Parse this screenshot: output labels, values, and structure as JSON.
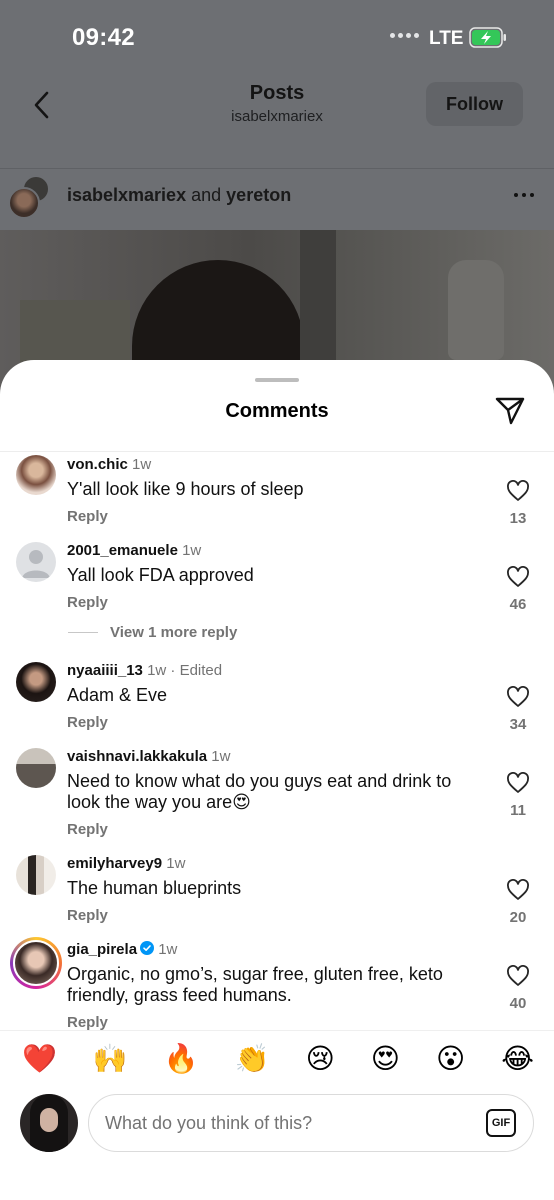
{
  "status_bar": {
    "time": "09:42",
    "network": "LTE"
  },
  "header": {
    "title": "Posts",
    "subtitle": "isabelxmariex",
    "follow_label": "Follow"
  },
  "post": {
    "author1": "isabelxmariex",
    "joiner": "and",
    "author2": "yereton"
  },
  "sheet": {
    "title": "Comments"
  },
  "comments": [
    {
      "user": "von.chic",
      "meta": "1w",
      "text": "Y'all look like 9 hours of sleep",
      "reply": "Reply",
      "likes": "13"
    },
    {
      "user": "2001_emanuele",
      "meta": "1w",
      "text": "Yall look FDA approved",
      "reply": "Reply",
      "likes": "46",
      "view_more": "View 1 more reply"
    },
    {
      "user": "nyaaiiii_13",
      "meta": "1w · Edited",
      "text": "Adam & Eve",
      "reply": "Reply",
      "likes": "34"
    },
    {
      "user": "vaishnavi.lakkakula",
      "meta": "1w",
      "text": "Need to know what do you guys eat and drink to look the way you are😍",
      "reply": "Reply",
      "likes": "11"
    },
    {
      "user": "emilyharvey9",
      "meta": "1w",
      "text": "The human blueprints",
      "reply": "Reply",
      "likes": "20"
    },
    {
      "user": "gia_pirela",
      "meta": "1w",
      "verified": true,
      "text": "Organic, no gmo’s, sugar free, gluten free, keto friendly, grass feed humans.",
      "reply": "Reply",
      "likes": "40"
    }
  ],
  "quick_reactions": [
    "❤️",
    "🙌",
    "🔥",
    "👏",
    "😢",
    "😍",
    "😮",
    "😂"
  ],
  "composer": {
    "placeholder": "What do you think of this?",
    "gif_label": "GIF"
  },
  "colors": {
    "verified_blue": "#0095f6",
    "battery_green": "#34c759",
    "secondary_text": "#737373"
  }
}
